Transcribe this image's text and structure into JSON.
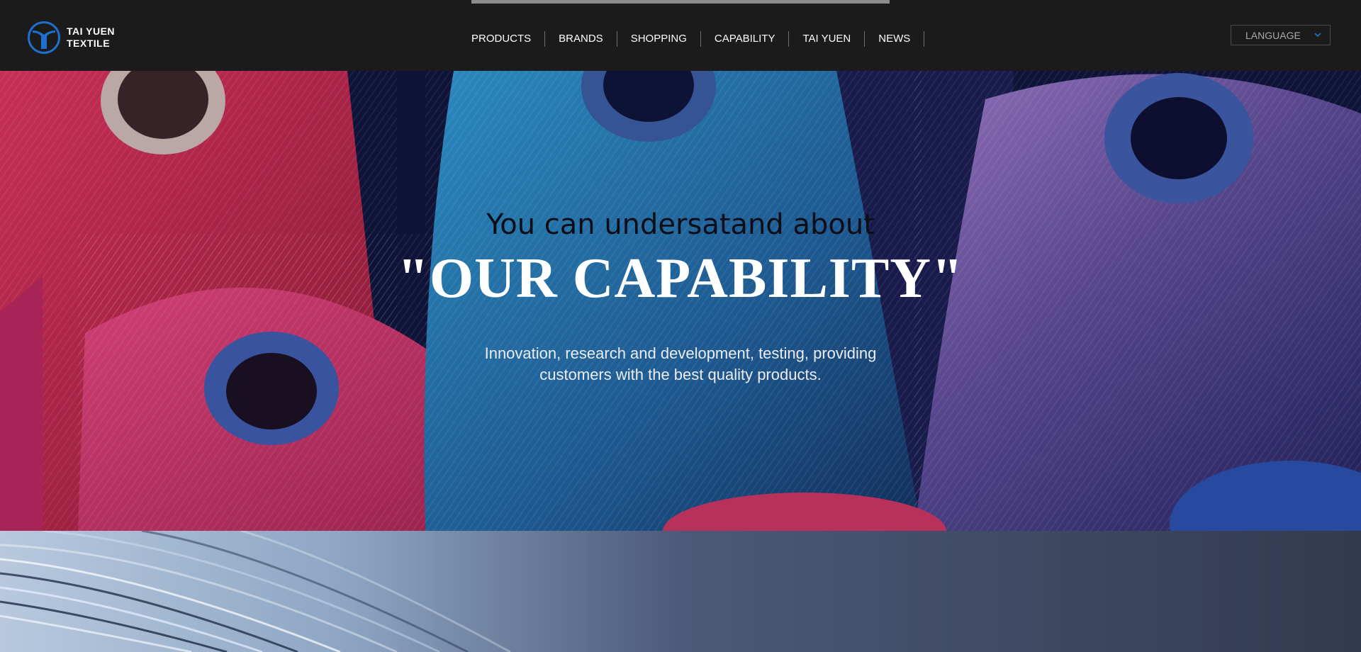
{
  "header": {
    "logo": {
      "icon": "ty-logo-icon",
      "line1": "TAI YUEN",
      "line2": "TEXTILE"
    },
    "nav": [
      {
        "label": "PRODUCTS"
      },
      {
        "label": "BRANDS"
      },
      {
        "label": "SHOPPING"
      },
      {
        "label": "CAPABILITY"
      },
      {
        "label": "TAI YUEN"
      },
      {
        "label": "NEWS"
      }
    ],
    "language": {
      "label": "LANGUAGE",
      "icon": "chevron-down-icon"
    }
  },
  "hero": {
    "subtitle": "You can undersatand about",
    "title": "\"OUR CAPABILITY\"",
    "description": "Innovation, research and development, testing, providing customers with the best quality products."
  },
  "colors": {
    "header_bg": "#1b1b1b",
    "accent_blue": "#1e6fd0",
    "nav_text": "#ffffff",
    "divider": "#6e6e6e"
  }
}
